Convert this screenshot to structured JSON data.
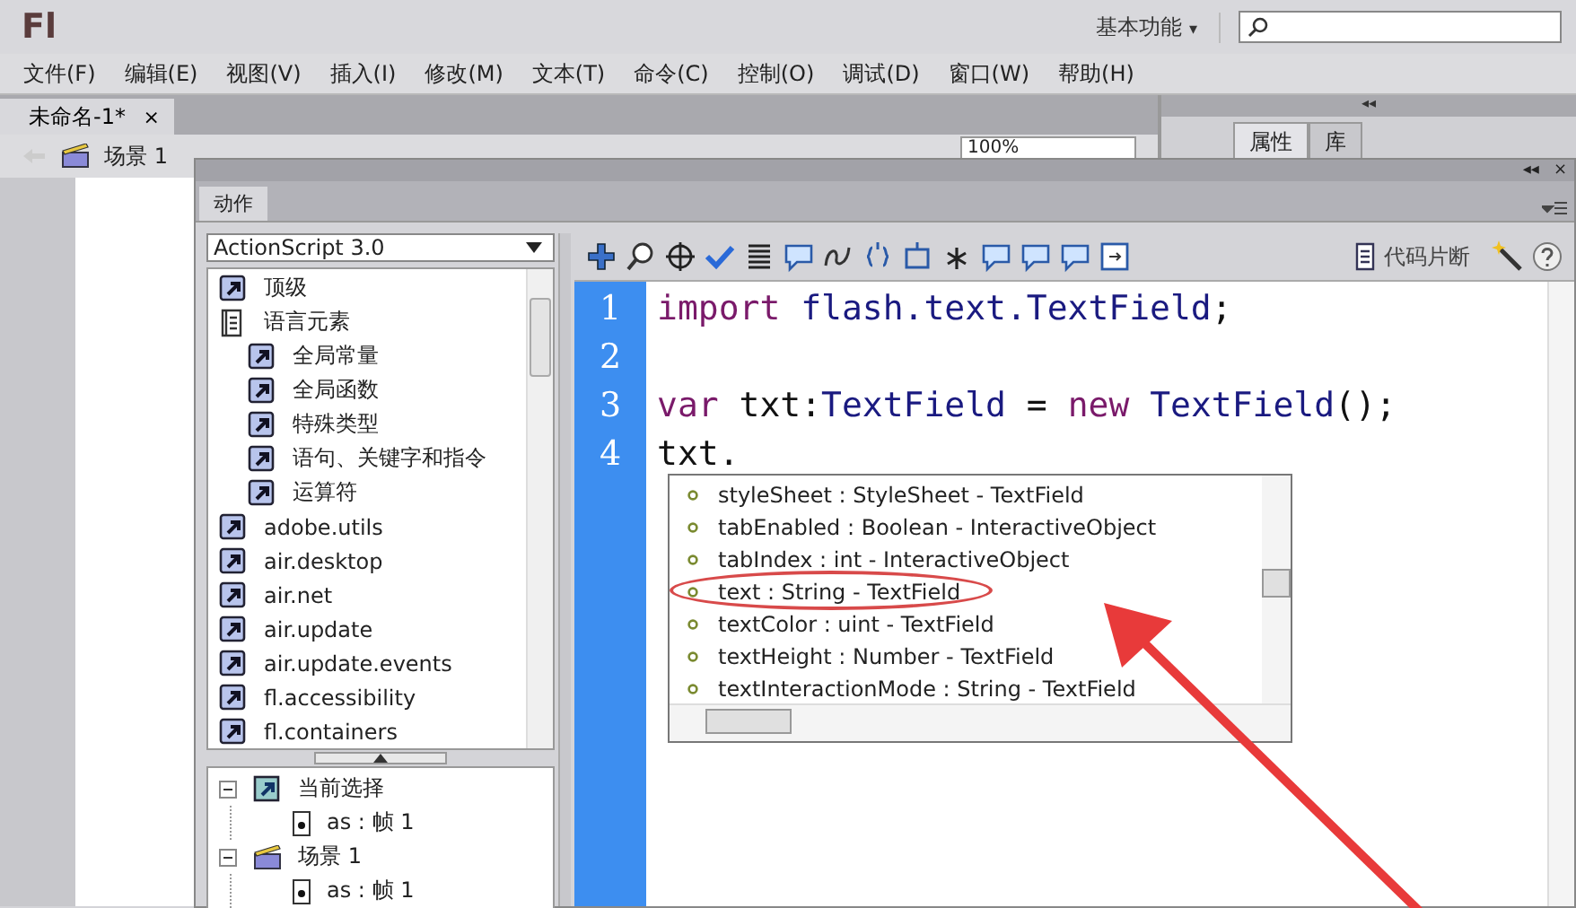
{
  "app": {
    "logo": "Fl",
    "workspace": "基本功能",
    "workspace_caret": "▾"
  },
  "menu": [
    "文件(F)",
    "编辑(E)",
    "视图(V)",
    "插入(I)",
    "修改(M)",
    "文本(T)",
    "命令(C)",
    "控制(O)",
    "调试(D)",
    "窗口(W)",
    "帮助(H)"
  ],
  "document_tab": {
    "label": "未命名-1*",
    "close": "×"
  },
  "breadcrumb": {
    "scene": "场景 1",
    "zoom": "100%"
  },
  "right_panel": {
    "collapse": "◂◂",
    "tabs": [
      {
        "label": "属性",
        "selected": true
      },
      {
        "label": "库",
        "selected": false
      }
    ]
  },
  "actions_panel": {
    "collapse": "◂◂",
    "close": "×",
    "tab": "动作",
    "language": "ActionScript 3.0",
    "snippets": "代码片断",
    "library_tree": [
      {
        "label": "顶级",
        "kind": "package"
      },
      {
        "label": "语言元素",
        "kind": "book",
        "children": [
          {
            "label": "全局常量",
            "kind": "package"
          },
          {
            "label": "全局函数",
            "kind": "package"
          },
          {
            "label": "特殊类型",
            "kind": "package"
          },
          {
            "label": "语句、关键字和指令",
            "kind": "package"
          },
          {
            "label": "运算符",
            "kind": "package"
          }
        ]
      },
      {
        "label": "adobe.utils",
        "kind": "package"
      },
      {
        "label": "air.desktop",
        "kind": "package"
      },
      {
        "label": "air.net",
        "kind": "package"
      },
      {
        "label": "air.update",
        "kind": "package"
      },
      {
        "label": "air.update.events",
        "kind": "package"
      },
      {
        "label": "fl.accessibility",
        "kind": "package"
      },
      {
        "label": "fl.containers",
        "kind": "package"
      }
    ],
    "script_tree": [
      {
        "label": "当前选择",
        "kind": "selection",
        "expanded": true,
        "children": [
          {
            "label": "as : 帧 1",
            "kind": "frame"
          }
        ]
      },
      {
        "label": "场景 1",
        "kind": "scene",
        "expanded": true,
        "children": [
          {
            "label": "as : 帧 1",
            "kind": "frame"
          }
        ]
      }
    ],
    "code": [
      {
        "number": "1",
        "tokens": [
          {
            "text": "import",
            "kind": "keyword"
          },
          {
            "text": " flash.text.TextField",
            "kind": "type"
          },
          {
            "text": ";",
            "kind": "plain"
          }
        ]
      },
      {
        "number": "2"
      },
      {
        "number": "3",
        "tokens": [
          {
            "text": "var",
            "kind": "keyword"
          },
          {
            "text": " txt:",
            "kind": "plain"
          },
          {
            "text": "TextField",
            "kind": "type"
          },
          {
            "text": " = ",
            "kind": "plain"
          },
          {
            "text": "new",
            "kind": "keyword"
          },
          {
            "text": " TextField",
            "kind": "type"
          },
          {
            "text": "();",
            "kind": "plain"
          }
        ]
      },
      {
        "number": "4",
        "tokens": [
          {
            "text": "txt.",
            "kind": "plain"
          }
        ]
      }
    ],
    "completion": [
      {
        "text": "styleSheet : StyleSheet - TextField",
        "circled": false
      },
      {
        "text": "tabEnabled : Boolean - InteractiveObject",
        "circled": false
      },
      {
        "text": "tabIndex : int - InteractiveObject",
        "circled": false
      },
      {
        "text": "text : String - TextField",
        "circled": true
      },
      {
        "text": "textColor : uint - TextField",
        "circled": false
      },
      {
        "text": "textHeight : Number - TextField",
        "circled": false
      },
      {
        "text": "textInteractionMode : String - TextField",
        "circled": false
      }
    ]
  }
}
